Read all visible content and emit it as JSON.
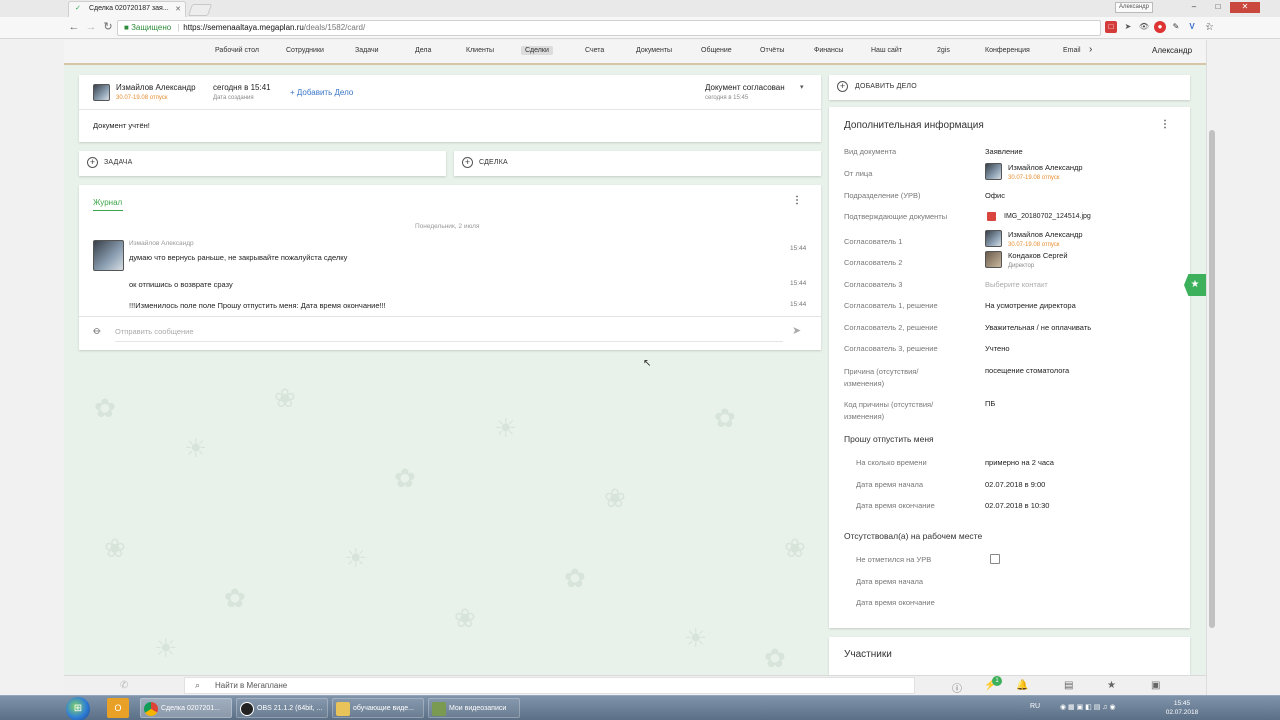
{
  "browser": {
    "tab_title": "Сделка 020720187 зая...",
    "user_chip": "Александр",
    "secure_label": "Защищено",
    "url_host": "https://semenaaltaya.megaplan.ru",
    "url_path": "/deals/1582/card/"
  },
  "nav": {
    "items": [
      "Рабочий стол",
      "Сотрудники",
      "Задачи",
      "Дела",
      "Клиенты",
      "Сделки",
      "Счета",
      "Документы",
      "Общение",
      "Отчёты",
      "Финансы",
      "Наш сайт",
      "2gis",
      "Конференция",
      "Email"
    ],
    "active": "Сделки",
    "more_glyph": "›",
    "user": "Александр"
  },
  "doc_card": {
    "author": "Измайлов Александр",
    "author_status": "30.07-19.08 отпуск",
    "created": "сегодня в 15:41",
    "created_label": "Дата создания",
    "add_task_link": "+ Добавить Дело",
    "status": "Документ согласован",
    "status_time": "сегодня в 15:45",
    "body": "Документ учтён!"
  },
  "actions": {
    "task_label": "ЗАДАЧА",
    "deal_label": "СДЕЛКА",
    "add_deal_label": "ДОБАВИТЬ ДЕЛО"
  },
  "journal": {
    "tab": "Журнал",
    "date_divider": "Понедельник, 2 июля",
    "author": "Измайлов Александр",
    "messages": [
      {
        "text": "думаю что вернусь раньше, не закрывайте пожалуйста сделку",
        "time": "15:44"
      },
      {
        "text": "ок отпишись о возврате сразу",
        "time": "15:44"
      },
      {
        "text": "!!!Изменилось поле поле Прошу отпустить меня: Дата время окончание!!!",
        "time": "15:44"
      }
    ],
    "input_placeholder": "Отправить сообщение"
  },
  "info": {
    "title": "Дополнительная информация",
    "rows": [
      {
        "label": "Вид документа",
        "value": "Заявление"
      },
      {
        "label": "От лица",
        "value": "Измайлов Александр",
        "sub": "30.07-19.08 отпуск"
      },
      {
        "label": "Подразделение (УРВ)",
        "value": "Офис"
      },
      {
        "label": "Подтверждающие документы",
        "value": "IMG_20180702_124514.jpg"
      },
      {
        "label": "Согласователь 1",
        "value": "Измайлов Александр",
        "sub": "30.07-19.08 отпуск"
      },
      {
        "label": "Согласователь 2",
        "value": "Кондаков Сергей",
        "sub": "Директор"
      },
      {
        "label": "Согласователь 3",
        "value": "Выберите контакт"
      },
      {
        "label": "Согласователь 1, решение",
        "value": "На усмотрение директора"
      },
      {
        "label": "Согласователь 2, решение",
        "value": "Уважительная / не оплачивать"
      },
      {
        "label": "Согласователь 3, решение",
        "value": "Учтено"
      },
      {
        "label": "Причина (отсутствия/ изменения)",
        "value": "посещение стоматолога"
      },
      {
        "label": "Код причины (отсутствия/ изменения)",
        "value": "ПБ"
      }
    ],
    "leave_section": "Прошу отпустить меня",
    "leave_rows": [
      {
        "label": "На сколько времени",
        "value": "примерно на 2 часа"
      },
      {
        "label": "Дата время начала",
        "value": "02.07.2018 в 9:00"
      },
      {
        "label": "Дата время окончание",
        "value": "02.07.2018 в 10:30"
      }
    ],
    "absent_section": "Отсутствовал(а) на рабочем месте",
    "absent_rows": [
      {
        "label": "Не отметился на УРВ",
        "value": ""
      },
      {
        "label": "Дата время начала",
        "value": ""
      },
      {
        "label": "Дата время окончание",
        "value": ""
      }
    ]
  },
  "participants": {
    "title": "Участники"
  },
  "bottom": {
    "search_placeholder": "Найти в Мегаплане",
    "badge": "1"
  },
  "taskbar": {
    "items": [
      "Сделка 0207201...",
      "OBS 21.1.2 (64bit, ...",
      "обучающие виде...",
      "Мои видеозаписи"
    ],
    "lang": "RU",
    "time": "15:45",
    "date": "02.07.2018"
  },
  "colors": {
    "accent_green": "#3da74a",
    "link_blue": "#3a76c9",
    "orange": "#e78c2f"
  },
  "icons": {
    "back": "arrow-left-icon",
    "forward": "arrow-right-icon",
    "reload": "reload-icon",
    "attach": "paperclip-icon",
    "send": "send-icon",
    "search": "search-icon",
    "star": "star-icon"
  }
}
